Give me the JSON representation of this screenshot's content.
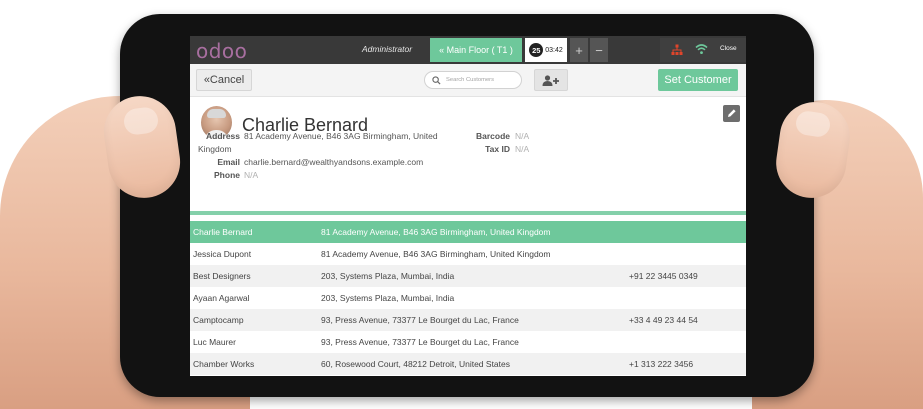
{
  "topbar": {
    "logo": "odoo",
    "user": "Administrator",
    "floor_tab": "« Main Floor ( T1 )",
    "order_number": "25",
    "order_time": "03:42",
    "plus_label": "+",
    "minus_label": "−",
    "close_label": "Close",
    "accent_color": "#6ec89b"
  },
  "toolbar": {
    "cancel_label": "«Cancel",
    "search_placeholder": "Search Customers",
    "set_customer_label": "Set Customer"
  },
  "customer": {
    "name": "Charlie Bernard",
    "address_label": "Address",
    "address_line1": "81 Academy Avenue, B46 3AG Birmingham, United",
    "address_line2": "Kingdom",
    "email_label": "Email",
    "email": "charlie.bernard@wealthyandsons.example.com",
    "phone_label": "Phone",
    "phone": "N/A",
    "barcode_label": "Barcode",
    "barcode": "N/A",
    "taxid_label": "Tax ID",
    "taxid": "N/A"
  },
  "customers": [
    {
      "name": "Charlie Bernard",
      "address": "81 Academy Avenue, B46 3AG Birmingham, United Kingdom",
      "phone": "",
      "selected": true
    },
    {
      "name": "Jessica Dupont",
      "address": "81 Academy Avenue, B46 3AG Birmingham, United Kingdom",
      "phone": ""
    },
    {
      "name": "Best Designers",
      "address": "203, Systems Plaza, Mumbai, India",
      "phone": "+91 22 3445 0349"
    },
    {
      "name": "Ayaan Agarwal",
      "address": "203, Systems Plaza, Mumbai, India",
      "phone": ""
    },
    {
      "name": "Camptocamp",
      "address": "93, Press Avenue, 73377 Le Bourget du Lac, France",
      "phone": "+33 4 49 23 44 54"
    },
    {
      "name": "Luc Maurer",
      "address": "93, Press Avenue, 73377 Le Bourget du Lac, France",
      "phone": ""
    },
    {
      "name": "Chamber Works",
      "address": "60, Rosewood Court, 48212 Detroit, United States",
      "phone": "+1 313 222 3456"
    }
  ]
}
